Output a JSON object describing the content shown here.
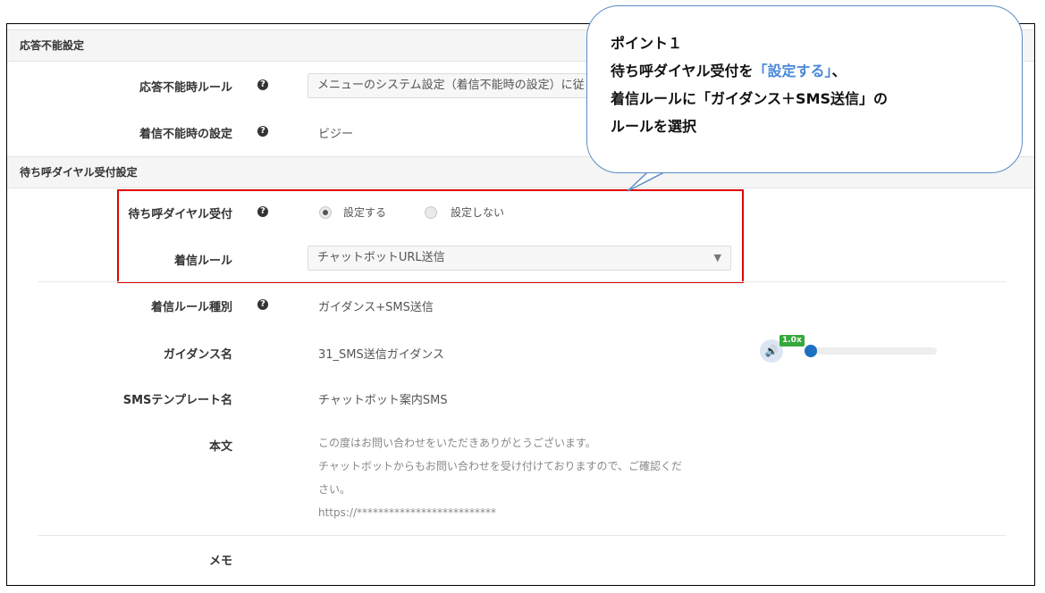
{
  "sections": {
    "unanswerable": {
      "title": "応答不能設定"
    },
    "waiting": {
      "title": "待ち呼ダイヤル受付設定"
    }
  },
  "fields": {
    "unanswerable_rule": {
      "label": "応答不能時ルール",
      "value": "メニューのシステム設定（着信不能時の設定）に従"
    },
    "unreachable_setting": {
      "label": "着信不能時の設定",
      "value": "ビジー"
    },
    "waiting_dial": {
      "label": "待ち呼ダイヤル受付",
      "option_on": "設定する",
      "option_off": "設定しない",
      "selected": "設定する"
    },
    "incoming_rule": {
      "label": "着信ルール",
      "value": "チャットボットURL送信"
    },
    "rule_type": {
      "label": "着信ルール種別",
      "value": "ガイダンス+SMS送信"
    },
    "guidance_name": {
      "label": "ガイダンス名",
      "value": "31_SMS送信ガイダンス",
      "speed": "1.0x",
      "progress": 0
    },
    "sms_template": {
      "label": "SMSテンプレート名",
      "value": "チャットボット案内SMS"
    },
    "body": {
      "label": "本文",
      "lines": [
        "この度はお問い合わせをいただきありがとうございます。",
        "チャットボットからもお問い合わせを受け付けておりますので、ご確認くだ",
        "さい。",
        "https://**************************"
      ]
    },
    "memo": {
      "label": "メモ"
    }
  },
  "callout": {
    "line1": "ポイント１",
    "line2_pre": "待ち呼ダイヤル受付を",
    "line2_accent": "「設定する」",
    "line2_post": "、",
    "line3": "着信ルールに「ガイダンス＋SMS送信」の",
    "line4": "ルールを選択"
  },
  "icons": {
    "help": "question-circle-icon",
    "dropdown": "caret-down-icon",
    "speaker": "speaker-icon"
  },
  "colors": {
    "highlight": "#e00000",
    "callout_border": "#5b8cc6",
    "accent": "#4a88d8",
    "player": "#1c6fc1",
    "badge": "#35a93b"
  }
}
